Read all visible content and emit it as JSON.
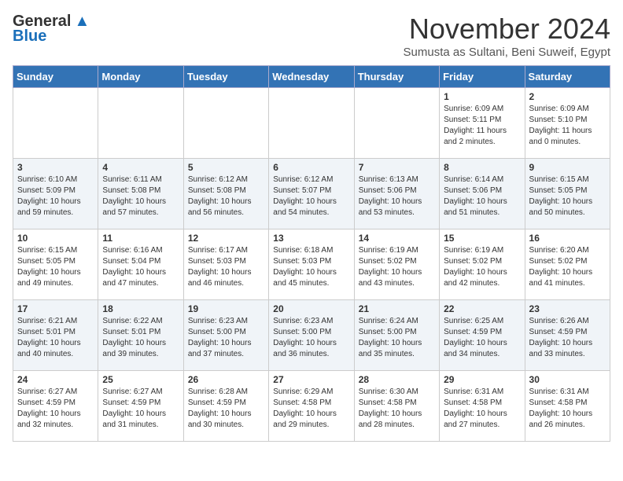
{
  "logo": {
    "general": "General",
    "blue": "Blue"
  },
  "title": "November 2024",
  "subtitle": "Sumusta as Sultani, Beni Suweif, Egypt",
  "days_of_week": [
    "Sunday",
    "Monday",
    "Tuesday",
    "Wednesday",
    "Thursday",
    "Friday",
    "Saturday"
  ],
  "weeks": [
    [
      {
        "day": "",
        "info": ""
      },
      {
        "day": "",
        "info": ""
      },
      {
        "day": "",
        "info": ""
      },
      {
        "day": "",
        "info": ""
      },
      {
        "day": "",
        "info": ""
      },
      {
        "day": "1",
        "info": "Sunrise: 6:09 AM\nSunset: 5:11 PM\nDaylight: 11 hours and 2 minutes."
      },
      {
        "day": "2",
        "info": "Sunrise: 6:09 AM\nSunset: 5:10 PM\nDaylight: 11 hours and 0 minutes."
      }
    ],
    [
      {
        "day": "3",
        "info": "Sunrise: 6:10 AM\nSunset: 5:09 PM\nDaylight: 10 hours and 59 minutes."
      },
      {
        "day": "4",
        "info": "Sunrise: 6:11 AM\nSunset: 5:08 PM\nDaylight: 10 hours and 57 minutes."
      },
      {
        "day": "5",
        "info": "Sunrise: 6:12 AM\nSunset: 5:08 PM\nDaylight: 10 hours and 56 minutes."
      },
      {
        "day": "6",
        "info": "Sunrise: 6:12 AM\nSunset: 5:07 PM\nDaylight: 10 hours and 54 minutes."
      },
      {
        "day": "7",
        "info": "Sunrise: 6:13 AM\nSunset: 5:06 PM\nDaylight: 10 hours and 53 minutes."
      },
      {
        "day": "8",
        "info": "Sunrise: 6:14 AM\nSunset: 5:06 PM\nDaylight: 10 hours and 51 minutes."
      },
      {
        "day": "9",
        "info": "Sunrise: 6:15 AM\nSunset: 5:05 PM\nDaylight: 10 hours and 50 minutes."
      }
    ],
    [
      {
        "day": "10",
        "info": "Sunrise: 6:15 AM\nSunset: 5:05 PM\nDaylight: 10 hours and 49 minutes."
      },
      {
        "day": "11",
        "info": "Sunrise: 6:16 AM\nSunset: 5:04 PM\nDaylight: 10 hours and 47 minutes."
      },
      {
        "day": "12",
        "info": "Sunrise: 6:17 AM\nSunset: 5:03 PM\nDaylight: 10 hours and 46 minutes."
      },
      {
        "day": "13",
        "info": "Sunrise: 6:18 AM\nSunset: 5:03 PM\nDaylight: 10 hours and 45 minutes."
      },
      {
        "day": "14",
        "info": "Sunrise: 6:19 AM\nSunset: 5:02 PM\nDaylight: 10 hours and 43 minutes."
      },
      {
        "day": "15",
        "info": "Sunrise: 6:19 AM\nSunset: 5:02 PM\nDaylight: 10 hours and 42 minutes."
      },
      {
        "day": "16",
        "info": "Sunrise: 6:20 AM\nSunset: 5:02 PM\nDaylight: 10 hours and 41 minutes."
      }
    ],
    [
      {
        "day": "17",
        "info": "Sunrise: 6:21 AM\nSunset: 5:01 PM\nDaylight: 10 hours and 40 minutes."
      },
      {
        "day": "18",
        "info": "Sunrise: 6:22 AM\nSunset: 5:01 PM\nDaylight: 10 hours and 39 minutes."
      },
      {
        "day": "19",
        "info": "Sunrise: 6:23 AM\nSunset: 5:00 PM\nDaylight: 10 hours and 37 minutes."
      },
      {
        "day": "20",
        "info": "Sunrise: 6:23 AM\nSunset: 5:00 PM\nDaylight: 10 hours and 36 minutes."
      },
      {
        "day": "21",
        "info": "Sunrise: 6:24 AM\nSunset: 5:00 PM\nDaylight: 10 hours and 35 minutes."
      },
      {
        "day": "22",
        "info": "Sunrise: 6:25 AM\nSunset: 4:59 PM\nDaylight: 10 hours and 34 minutes."
      },
      {
        "day": "23",
        "info": "Sunrise: 6:26 AM\nSunset: 4:59 PM\nDaylight: 10 hours and 33 minutes."
      }
    ],
    [
      {
        "day": "24",
        "info": "Sunrise: 6:27 AM\nSunset: 4:59 PM\nDaylight: 10 hours and 32 minutes."
      },
      {
        "day": "25",
        "info": "Sunrise: 6:27 AM\nSunset: 4:59 PM\nDaylight: 10 hours and 31 minutes."
      },
      {
        "day": "26",
        "info": "Sunrise: 6:28 AM\nSunset: 4:59 PM\nDaylight: 10 hours and 30 minutes."
      },
      {
        "day": "27",
        "info": "Sunrise: 6:29 AM\nSunset: 4:58 PM\nDaylight: 10 hours and 29 minutes."
      },
      {
        "day": "28",
        "info": "Sunrise: 6:30 AM\nSunset: 4:58 PM\nDaylight: 10 hours and 28 minutes."
      },
      {
        "day": "29",
        "info": "Sunrise: 6:31 AM\nSunset: 4:58 PM\nDaylight: 10 hours and 27 minutes."
      },
      {
        "day": "30",
        "info": "Sunrise: 6:31 AM\nSunset: 4:58 PM\nDaylight: 10 hours and 26 minutes."
      }
    ]
  ]
}
